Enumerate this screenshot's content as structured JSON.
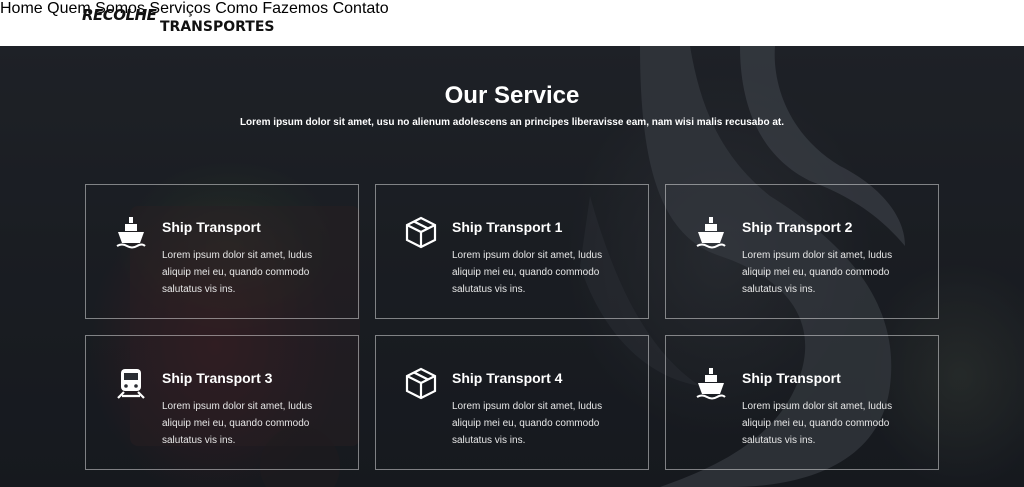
{
  "header": {
    "logo_top": "RECOLHE",
    "logo_bottom": "TRANSPORTES",
    "nav": [
      "Home",
      "Quem Somos",
      "Serviços",
      "Como Fazemos",
      "Contato"
    ]
  },
  "section": {
    "title": "Our Service",
    "subtitle": "Lorem ipsum dolor sit amet, usu no alienum adolescens an principes liberavisse eam, nam wisi malis recusabo at."
  },
  "cards": [
    {
      "icon": "ship-icon",
      "title": "Ship Transport",
      "text": "Lorem ipsum dolor sit amet, ludus aliquip mei eu, quando commodo salutatus vis ins."
    },
    {
      "icon": "box-icon",
      "title": "Ship Transport 1",
      "text": "Lorem ipsum dolor sit amet, ludus aliquip mei eu, quando commodo salutatus vis ins."
    },
    {
      "icon": "ship-icon",
      "title": "Ship Transport 2",
      "text": "Lorem ipsum dolor sit amet, ludus aliquip mei eu, quando commodo salutatus vis ins."
    },
    {
      "icon": "train-icon",
      "title": "Ship Transport 3",
      "text": "Lorem ipsum dolor sit amet, ludus aliquip mei eu, quando commodo salutatus vis ins."
    },
    {
      "icon": "box-icon",
      "title": "Ship Transport 4",
      "text": "Lorem ipsum dolor sit amet, ludus aliquip mei eu, quando commodo salutatus vis ins."
    },
    {
      "icon": "ship-icon",
      "title": "Ship Transport",
      "text": "Lorem ipsum dolor sit amet, ludus aliquip mei eu, quando commodo salutatus vis ins."
    }
  ]
}
